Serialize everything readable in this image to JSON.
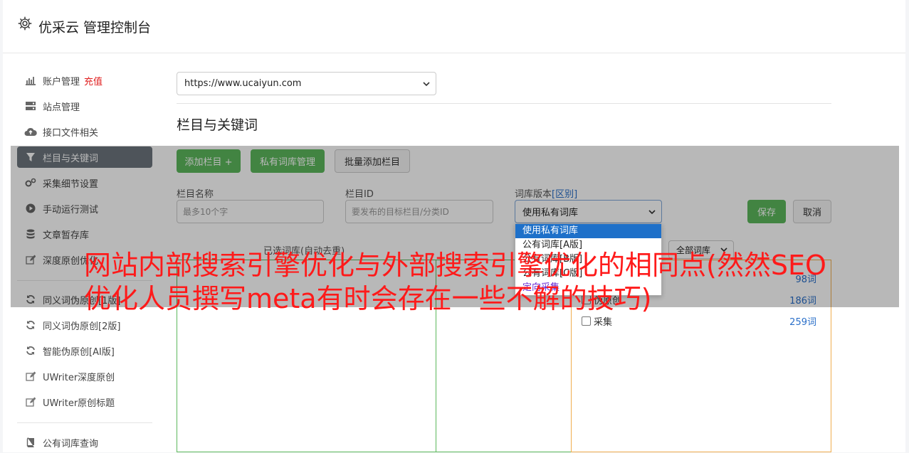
{
  "header": {
    "title": "优采云 管理控制台"
  },
  "sidebar": {
    "items": [
      {
        "label": "账户管理",
        "badge": "充值",
        "icon": "bar-chart-icon"
      },
      {
        "label": "站点管理",
        "icon": "server-icon"
      },
      {
        "label": "接口文件相关",
        "icon": "cloud-upload-icon"
      },
      {
        "label": "栏目与关键词",
        "icon": "filter-icon"
      },
      {
        "label": "采集细节设置",
        "icon": "gears-icon"
      },
      {
        "label": "手动运行测试",
        "icon": "play-icon"
      },
      {
        "label": "文章暂存库",
        "icon": "database-icon"
      },
      {
        "label": "深度原创优化",
        "icon": "edit-icon"
      },
      {
        "label": "同义词伪原创[1版]",
        "icon": "refresh-icon"
      },
      {
        "label": "同义词伪原创[2版]",
        "icon": "refresh-icon"
      },
      {
        "label": "智能伪原创[AI版]",
        "icon": "refresh-icon"
      },
      {
        "label": "UWriter深度原创",
        "icon": "edit-icon"
      },
      {
        "label": "UWriter原创标题",
        "icon": "edit-icon"
      },
      {
        "label": "公有词库查询",
        "icon": "book-icon"
      }
    ]
  },
  "site_select": {
    "value": "https://www.ucaiyun.com"
  },
  "section_title": "栏目与关键词",
  "toolbar": {
    "add_column": "添加栏目 +",
    "private_lib": "私有词库管理",
    "batch_add": "批量添加栏目"
  },
  "form": {
    "name_label": "栏目名称",
    "name_placeholder": "最多10个字",
    "id_label": "栏目ID",
    "id_placeholder": "要发布的目标栏目/分类ID",
    "version_label": "词库版本",
    "version_link": "[区别]",
    "version_value": "使用私有词库",
    "save": "保存",
    "cancel": "取消"
  },
  "dropdown": {
    "options": [
      "使用私有词库",
      "公有词库[A版]",
      "公有词库[B版]",
      "公有词库[C版]",
      "定向采集"
    ]
  },
  "selected_hint": "已选词库(自动去重)",
  "filter_select": {
    "value": "全部词库"
  },
  "libraries": [
    {
      "name": "",
      "count": "98词"
    },
    {
      "name": "伪原创",
      "count": "186词"
    },
    {
      "name": "采集",
      "count": "259词"
    }
  ],
  "banner": "网站内部搜索引擎优化与外部搜索引擎优化的相同点(然然SEO优化人员撰写meta有时会存在一些不解的技巧)",
  "colors": {
    "green": "#5cb85c",
    "banner_red": "#ff1a1a",
    "active_nav": "#6c757d"
  }
}
